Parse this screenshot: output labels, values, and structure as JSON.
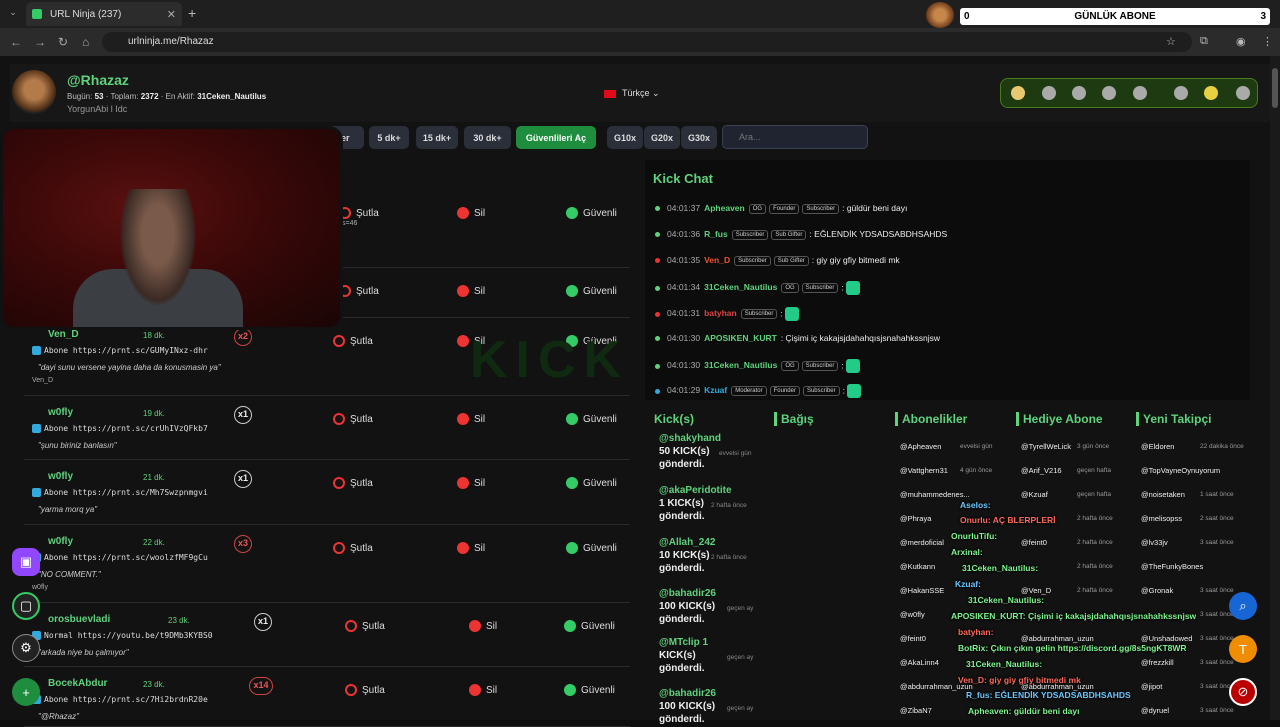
{
  "browser": {
    "tab_title": "URL Ninja (237)",
    "url": "urlninja.me/Rhazaz"
  },
  "abone_bar": {
    "count": "0",
    "label": "GÜNLÜK ABONE",
    "right": "3"
  },
  "header": {
    "username": "@Rhazaz",
    "today_label": "Bugün:",
    "today_value": "53",
    "total_label": "Toplam:",
    "total_value": "2372",
    "active_label": "En Aktif:",
    "active_value": "31Ceken_Nautilus",
    "subtitle": "YorgunAbi l Idc",
    "language": "Türkçe"
  },
  "toolbar": {
    "partial_label": "ler",
    "buttons": [
      "5 dk+",
      "15 dk+",
      "30 dk+"
    ],
    "trust_label": "Güvenlileri Aç",
    "g_buttons": [
      "G10x",
      "G20x",
      "G30x"
    ],
    "search_placeholder": "Ara..."
  },
  "actions": {
    "ban": "Şutla",
    "delete": "Sil",
    "safe": "Güvenli"
  },
  "rows": [
    {
      "name": "",
      "time": "",
      "mult": "",
      "link": "",
      "comment": "",
      "foot": "s=46"
    },
    {
      "name": "",
      "time": "",
      "mult": "",
      "link": "",
      "comment": "",
      "foot": ""
    },
    {
      "name": "Ven_D",
      "time": "18 dk.",
      "mult": "x2",
      "link": "Abone https://prnt.sc/GUMyINxz-dhr",
      "comment": "\"dayi sunu versene yayina daha da konusmasin ya\"",
      "foot": "Ven_D"
    },
    {
      "name": "w0fly",
      "time": "19 dk.",
      "mult": "x1",
      "link": "Abone https://prnt.sc/crUhIVzQFkb7",
      "comment": "\"şunu biriniz banlasın\"",
      "foot": ""
    },
    {
      "name": "w0fly",
      "time": "21 dk.",
      "mult": "x1",
      "link": "Abone https://prnt.sc/Mh7Swzpnmgvi",
      "comment": "\"yarma morq ya\"",
      "foot": ""
    },
    {
      "name": "w0fly",
      "time": "22 dk.",
      "mult": "x3",
      "link": "Abone https://prnt.sc/woolzfMF9gCu",
      "comment": "\"NO COMMENT.\"",
      "foot": "w0fly"
    },
    {
      "name": "orosbuevladi",
      "time": "23 dk.",
      "mult": "x1",
      "link": "Normal https://youtu.be/t9DMb3KYBS0",
      "comment": "\"arkada niye bu çalmıyor\"",
      "foot": ""
    },
    {
      "name": "BocekAbdur",
      "time": "23 dk.",
      "mult": "x14",
      "link": "Abone https://prnt.sc/7Hi2brdnR20e",
      "comment": "\"@Rhazaz\"",
      "foot": ""
    }
  ],
  "chat": {
    "title": "Kick Chat",
    "messages": [
      {
        "time": "04:01:37",
        "user": "Apheaven",
        "color": "#5fd27c",
        "badges": [
          "OG",
          "Founder",
          "Subscriber"
        ],
        "text": ": güldür beni dayı",
        "dot": "#5fd27c"
      },
      {
        "time": "04:01:36",
        "user": "R_fus",
        "color": "#5fd27c",
        "badges": [
          "Subscriber",
          "Sub Gifter"
        ],
        "text": ": EĞLENDİK YDSADSABDHSAHDS",
        "dot": "#5fd27c"
      },
      {
        "time": "04:01:35",
        "user": "Ven_D",
        "color": "#e53",
        "badges": [
          "Subscriber",
          "Sub Gifter"
        ],
        "text": ": giy giy gfiy bitmedi mk",
        "dot": "#e33"
      },
      {
        "time": "04:01:34",
        "user": "31Ceken_Nautilus",
        "color": "#5fd27c",
        "badges": [
          "OG",
          "Subscriber"
        ],
        "text": ":",
        "dot": "#5fd27c"
      },
      {
        "time": "04:01:31",
        "user": "batyhan",
        "color": "#d44",
        "badges": [
          "Subscriber"
        ],
        "text": ":",
        "dot": "#e33"
      },
      {
        "time": "04:01:30",
        "user": "APOSIKEN_KURT",
        "color": "#5fd27c",
        "badges": [],
        "text": ": Çişimi iç kakajsjdahahqısjsnahahkssnjsw",
        "dot": "#5fd27c"
      },
      {
        "time": "04:01:30",
        "user": "31Ceken_Nautilus",
        "color": "#5fd27c",
        "badges": [
          "OG",
          "Subscriber"
        ],
        "text": ":",
        "dot": "#5fd27c"
      },
      {
        "time": "04:01:29",
        "user": "Kzuaf",
        "color": "#3ad",
        "badges": [
          "Moderator",
          "Founder",
          "Subscriber"
        ],
        "text": ":",
        "dot": "#3ad"
      }
    ]
  },
  "sections": {
    "kicks": "Kick(s)",
    "donations": "Bağış",
    "subs": "Abonelikler",
    "gift": "Hediye Abone",
    "follows": "Yeni Takipçi"
  },
  "kicks": [
    {
      "user": "@shakyhand",
      "amount": "50 KICK(s)",
      "suffix": "gönderdi.",
      "time": "evvelsi gün"
    },
    {
      "user": "@akaPeridotite",
      "amount": "1 KICK(s)",
      "suffix": "gönderdi.",
      "time": "2 hafta önce"
    },
    {
      "user": "@Allah_242",
      "amount": "10 KICK(s)",
      "suffix": "gönderdi.",
      "time": "2 hafta önce"
    },
    {
      "user": "@bahadir26",
      "amount": "100 KICK(s)",
      "suffix": "gönderdi.",
      "time": "geçen ay"
    },
    {
      "user": "@MTclip 1",
      "amount": "KICK(s)",
      "suffix": "gönderdi.",
      "time": "geçen ay"
    },
    {
      "user": "@bahadir26",
      "amount": "100 KICK(s)",
      "suffix": "gönderdi.",
      "time": "geçen ay"
    }
  ],
  "subs": [
    {
      "u": "@Apheaven",
      "t": "evvelsi gün"
    },
    {
      "u": "@Vattghern31",
      "t": "4 gün önce"
    },
    {
      "u": "@muhammedenes...",
      "t": ""
    },
    {
      "u": "@Phraya",
      "t": ""
    },
    {
      "u": "@merdoficial",
      "t": ""
    },
    {
      "u": "@Kutkann",
      "t": ""
    },
    {
      "u": "@HakanSSE",
      "t": ""
    },
    {
      "u": "@w0fly",
      "t": ""
    },
    {
      "u": "@feint0",
      "t": ""
    },
    {
      "u": "@AkaLinn4",
      "t": ""
    },
    {
      "u": "@abdurrahman_uzun",
      "t": ""
    },
    {
      "u": "@ZibaN7",
      "t": ""
    }
  ],
  "gifts": [
    {
      "u": "@TyrellWeLick",
      "t": "3 gün önce"
    },
    {
      "u": "@Arif_V216",
      "t": "geçen hafta"
    },
    {
      "u": "@Kzuaf",
      "t": "geçen hafta"
    },
    {
      "u": "",
      "t": "2 hafta önce"
    },
    {
      "u": "@feint0",
      "t": "2 hafta önce"
    },
    {
      "u": "",
      "t": "2 hafta önce"
    },
    {
      "u": "@Ven_D",
      "t": "2 hafta önce"
    },
    {
      "u": "",
      "t": ""
    },
    {
      "u": "@abdurrahman_uzun",
      "t": ""
    },
    {
      "u": "",
      "t": ""
    },
    {
      "u": "@abdurrahman_uzun",
      "t": ""
    },
    {
      "u": "",
      "t": ""
    }
  ],
  "follows": [
    {
      "u": "@Eldoren",
      "t": "22 dakika önce"
    },
    {
      "u": "@TopVayneOynuyorum",
      "t": ""
    },
    {
      "u": "@noisetaken",
      "t": "1 saat önce"
    },
    {
      "u": "@melisopss",
      "t": "2 saat önce"
    },
    {
      "u": "@lv33jv",
      "t": "3 saat önce"
    },
    {
      "u": "@TheFunkyBones",
      "t": ""
    },
    {
      "u": "@Gronak",
      "t": "3 saat önce"
    },
    {
      "u": "",
      "t": "3 saat önce"
    },
    {
      "u": "@Unshadowed",
      "t": "3 saat önce"
    },
    {
      "u": "@frezzkill",
      "t": "3 saat önce"
    },
    {
      "u": "@jipot",
      "t": "3 saat önce"
    },
    {
      "u": "@dyruel",
      "t": "3 saat önce"
    }
  ],
  "overlay": [
    "Aselos:",
    "Onurlu: AÇ BLERPLERİ",
    "OnurluTifu:",
    "Arxinal:",
    "31Ceken_Nautilus:",
    "Kzuaf:",
    "31Ceken_Nautilus:",
    "APOSIKEN_KURT: Çişimi iç kakajsjdahahqısjsnahahkssnjsw",
    "batyhan:",
    "BotRix: Çıkın çıkın gelin https://discord.gg/8s5ngKT8WR",
    "31Ceken_Nautilus:",
    "Ven_D: giy giy gfiy bitmedi mk",
    "R_fus: EĞLENDİK YDSADSABDHSAHDS",
    "Apheaven: güldür beni dayı"
  ]
}
